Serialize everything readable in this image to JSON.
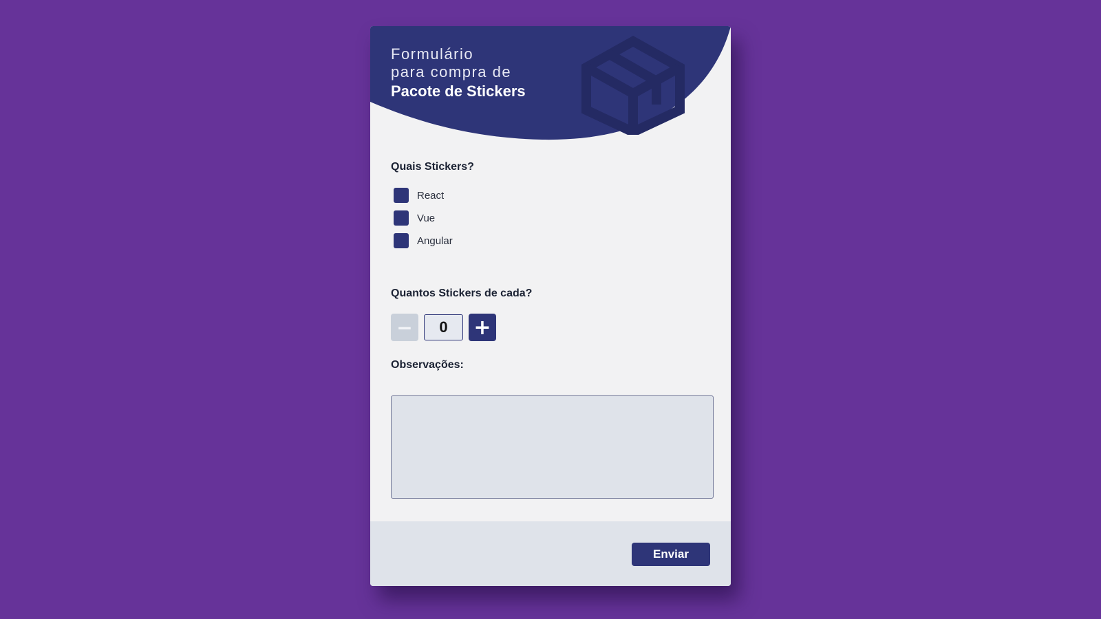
{
  "colors": {
    "background": "#663399",
    "primary": "#2e3578",
    "card": "#f2f2f3",
    "footer": "#dfe3ea",
    "disabled_button": "#c9d0da"
  },
  "header": {
    "line1": "Formulário",
    "line2": "para compra de",
    "title": "Pacote de Stickers",
    "icon": "package-box-icon"
  },
  "stickers": {
    "label": "Quais Stickers?",
    "options": [
      {
        "label": "React",
        "checked": false
      },
      {
        "label": "Vue",
        "checked": false
      },
      {
        "label": "Angular",
        "checked": false
      }
    ]
  },
  "quantity": {
    "label": "Quantos Stickers de cada?",
    "minus_symbol": "−",
    "plus_symbol": "+",
    "value": "0"
  },
  "notes": {
    "label": "Observações:",
    "value": "",
    "placeholder": ""
  },
  "footer": {
    "submit_label": "Enviar"
  }
}
